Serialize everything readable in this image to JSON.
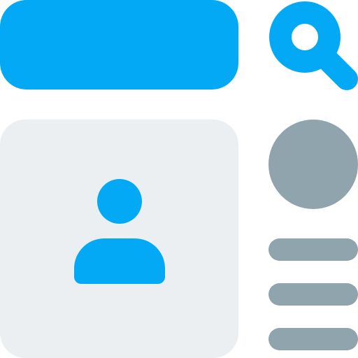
{
  "colors": {
    "accent": "#03A9F4",
    "muted": "#90A4AE",
    "card": "#ECEFF1",
    "background": "#FFFFFF"
  },
  "icons": {
    "search": "search-icon",
    "user": "user-icon"
  }
}
